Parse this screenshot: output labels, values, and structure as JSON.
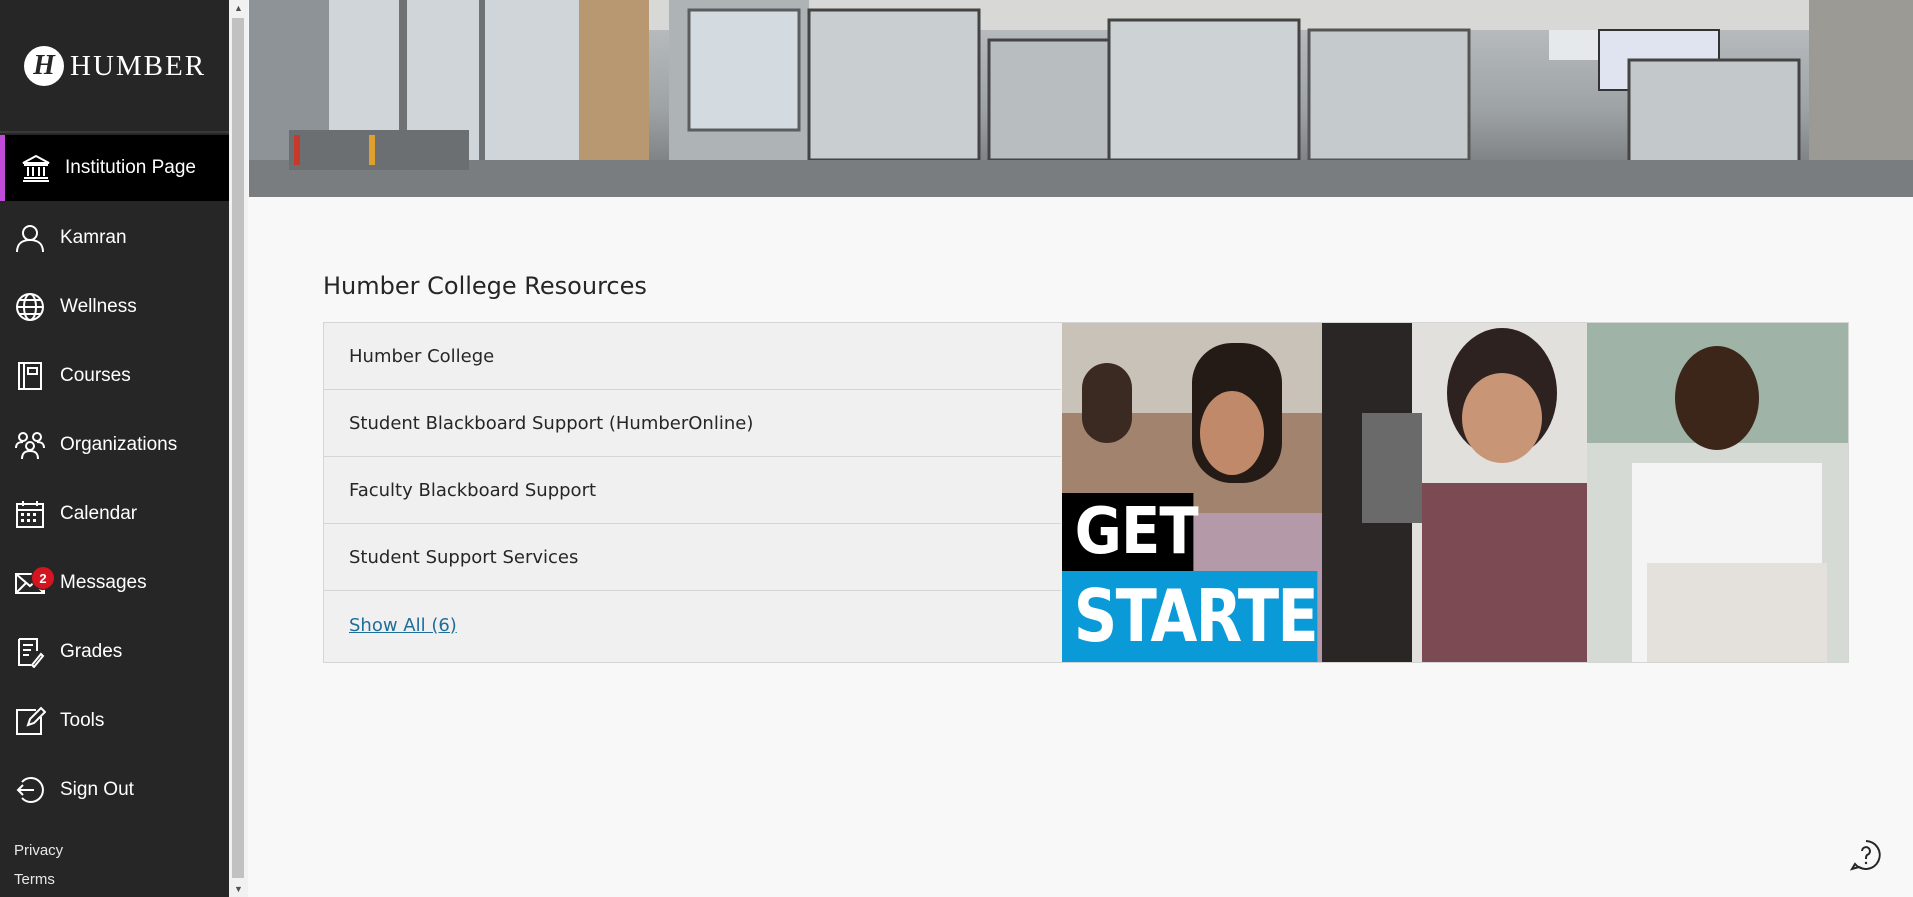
{
  "brand": {
    "logo_text": "HUMBER",
    "logo_mark": "H"
  },
  "sidebar": {
    "items": [
      {
        "label": "Institution Page",
        "icon": "institution-icon",
        "active": true
      },
      {
        "label": "Kamran",
        "icon": "user-icon"
      },
      {
        "label": "Wellness",
        "icon": "globe-icon"
      },
      {
        "label": "Courses",
        "icon": "courses-icon"
      },
      {
        "label": "Organizations",
        "icon": "organizations-icon"
      },
      {
        "label": "Calendar",
        "icon": "calendar-icon"
      },
      {
        "label": "Messages",
        "icon": "envelope-icon",
        "badge": "2"
      },
      {
        "label": "Grades",
        "icon": "grades-icon"
      },
      {
        "label": "Tools",
        "icon": "tools-icon"
      },
      {
        "label": "Sign Out",
        "icon": "sign-out-icon"
      }
    ],
    "footer": {
      "privacy": "Privacy",
      "terms": "Terms"
    }
  },
  "main": {
    "section_title": "Humber College Resources",
    "links": [
      "Humber College",
      "Student Blackboard Support (HumberOnline)",
      "Faculty Blackboard Support",
      "Student Support Services"
    ],
    "show_all": "Show All (6)",
    "promo": {
      "line1": "GET",
      "line2": "STARTED"
    }
  },
  "colors": {
    "sidebar_bg": "#262626",
    "active_accent": "#c04cd9",
    "badge": "#d4141e",
    "link": "#1f6e99",
    "promo_blue": "#0a9ad8"
  }
}
